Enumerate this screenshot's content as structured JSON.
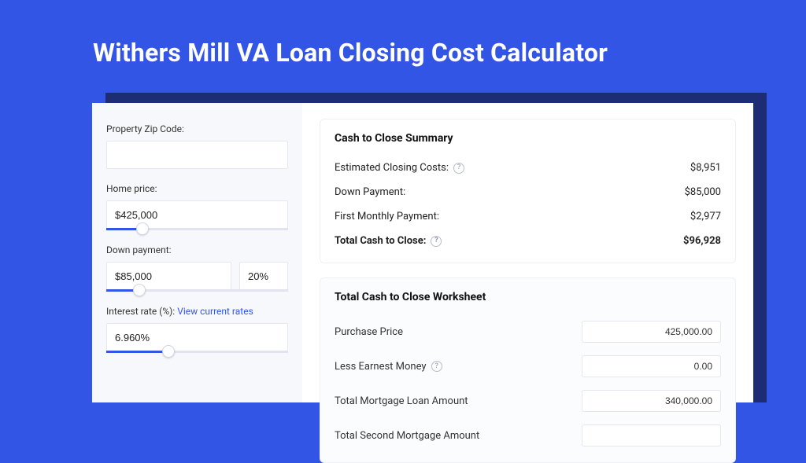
{
  "header": {
    "title": "Withers Mill VA Loan Closing Cost Calculator"
  },
  "sidebar": {
    "zip": {
      "label": "Property Zip Code:",
      "value": ""
    },
    "home_price": {
      "label": "Home price:",
      "value": "$425,000",
      "slider_pct": 20
    },
    "down_payment": {
      "label": "Down payment:",
      "value": "$85,000",
      "pct": "20%",
      "slider_pct": 18
    },
    "interest_rate": {
      "label": "Interest rate (%): ",
      "link": "View current rates",
      "value": "6.960%",
      "slider_pct": 34
    }
  },
  "summary": {
    "title": "Cash to Close Summary",
    "rows": [
      {
        "label": "Estimated Closing Costs:",
        "help": true,
        "value": "$8,951",
        "bold": false
      },
      {
        "label": "Down Payment:",
        "help": false,
        "value": "$85,000",
        "bold": false
      },
      {
        "label": "First Monthly Payment:",
        "help": false,
        "value": "$2,977",
        "bold": false
      },
      {
        "label": "Total Cash to Close:",
        "help": true,
        "value": "$96,928",
        "bold": true
      }
    ]
  },
  "worksheet": {
    "title": "Total Cash to Close Worksheet",
    "rows": [
      {
        "label": "Purchase Price",
        "help": false,
        "value": "425,000.00"
      },
      {
        "label": "Less Earnest Money",
        "help": true,
        "value": "0.00"
      },
      {
        "label": "Total Mortgage Loan Amount",
        "help": false,
        "value": "340,000.00"
      },
      {
        "label": "Total Second Mortgage Amount",
        "help": false,
        "value": ""
      }
    ]
  }
}
